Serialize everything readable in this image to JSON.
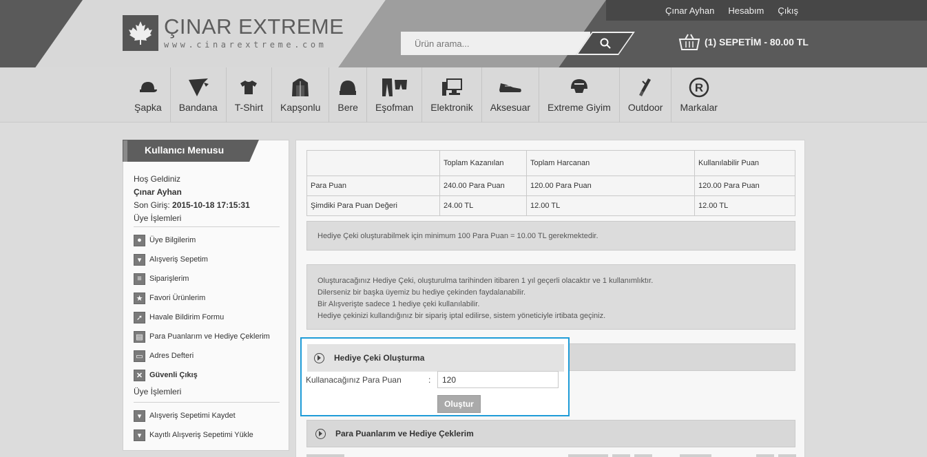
{
  "brand": {
    "title": "ÇINAR EXTREME",
    "subtitle": "www.cinarextreme.com",
    "icon": "maple-leaf-icon"
  },
  "search": {
    "placeholder": "Ürün arama...",
    "icon": "search-icon"
  },
  "toplinks": [
    "Çınar Ayhan",
    "Hesabım",
    "Çıkış"
  ],
  "cart": {
    "label": "(1) SEPETİM - 80.00 TL",
    "icon": "basket-icon"
  },
  "categories": [
    {
      "label": "Şapka",
      "icon": "cap-icon"
    },
    {
      "label": "Bandana",
      "icon": "bandana-icon"
    },
    {
      "label": "T-Shirt",
      "icon": "tshirt-icon"
    },
    {
      "label": "Kapşonlu",
      "icon": "hoodie-icon"
    },
    {
      "label": "Bere",
      "icon": "beanie-icon"
    },
    {
      "label": "Eşofman",
      "icon": "tracksuit-icon"
    },
    {
      "label": "Elektronik",
      "icon": "computer-icon"
    },
    {
      "label": "Aksesuar",
      "icon": "shoe-icon"
    },
    {
      "label": "Extreme Giyim",
      "icon": "helmet-icon"
    },
    {
      "label": "Outdoor",
      "icon": "knife-icon"
    },
    {
      "label": "Markalar",
      "icon": "registered-icon"
    }
  ],
  "sidebar": {
    "title": "Kullanıcı Menusu",
    "welcome": "Hoş Geldiniz",
    "user": "Çınar Ayhan",
    "last_login_label": "Son Giriş:",
    "last_login": "2015-10-18 17:15:31",
    "section1": "Üye İşlemleri",
    "items": [
      {
        "label": "Üye Bilgilerim",
        "icon": "user-icon"
      },
      {
        "label": "Alışveriş Sepetim",
        "icon": "basket-icon"
      },
      {
        "label": "Siparişlerim",
        "icon": "document-icon"
      },
      {
        "label": "Favori Ürünlerim",
        "icon": "star-icon"
      },
      {
        "label": "Havale Bildirim Formu",
        "icon": "arrow-icon"
      },
      {
        "label": "Para Puanlarım ve Hediye Çeklerim",
        "icon": "coins-icon"
      },
      {
        "label": "Adres Defteri",
        "icon": "address-book-icon"
      },
      {
        "label": "Güvenli Çıkış",
        "icon": "close-icon"
      }
    ],
    "section2": "Üye İşlemleri",
    "items2": [
      {
        "label": "Alışveriş Sepetimi Kaydet",
        "icon": "basket-save-icon"
      },
      {
        "label": "Kayıtlı Alışveriş Sepetimi Yükle",
        "icon": "basket-load-icon"
      }
    ]
  },
  "points_table": {
    "headers": [
      "",
      "Toplam Kazanılan",
      "Toplam Harcanan",
      "Kullanılabilir Puan"
    ],
    "rows": [
      [
        "Para Puan",
        "240.00 Para Puan",
        "120.00 Para Puan",
        "120.00 Para Puan"
      ],
      [
        "Şimdiki Para Puan Değeri",
        "24.00 TL",
        "12.00 TL",
        "12.00 TL"
      ]
    ]
  },
  "info_min": "Hediye Çeki oluşturabilmek için minimum 100 Para Puan = 10.00 TL gerekmektedir.",
  "info_lines": [
    "Oluşturacağınız Hediye Çeki, oluşturulma tarihinden itibaren 1 yıl geçerli olacaktır ve 1 kullanımlıktır.",
    "Dilerseniz bir başka üyemiz bu hediye çekinden faydalanabilir.",
    "Bir Alışverişte sadece 1 hediye çeki kullanılabilir.",
    "Hediye çekinizi kullandığınız bir sipariş iptal edilirse, sistem yöneticiyle irtibata geçiniz."
  ],
  "gift_form": {
    "title": "Hediye Çeki Oluşturma",
    "label": "Kullanacağınız Para Puan",
    "colon": ":",
    "value": "120",
    "button": "Oluştur"
  },
  "points_section_title": "Para Puanlarım ve Hediye Çeklerim"
}
